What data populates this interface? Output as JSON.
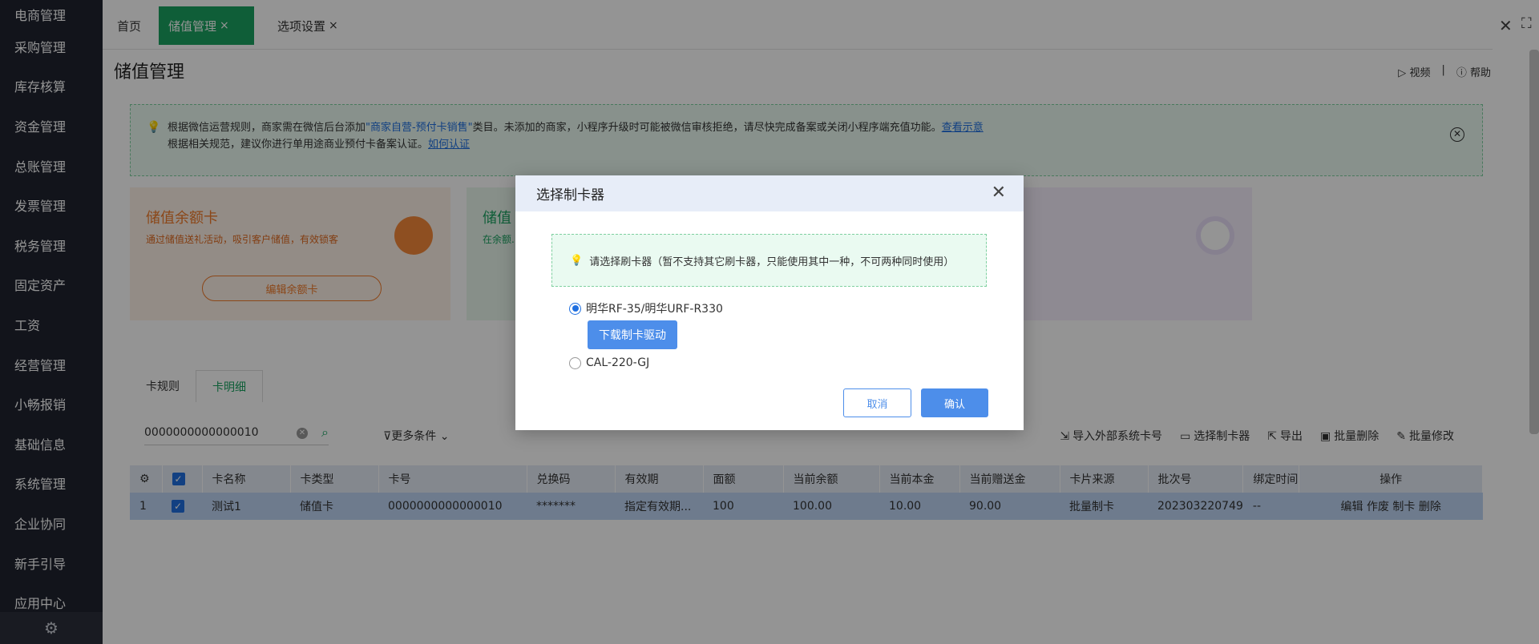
{
  "sidebar": {
    "items": [
      "电商管理",
      "采购管理",
      "库存核算",
      "资金管理",
      "总账管理",
      "发票管理",
      "税务管理",
      "固定资产",
      "工资",
      "经营管理",
      "小畅报销",
      "基础信息",
      "系统管理",
      "企业协同",
      "新手引导",
      "应用中心"
    ],
    "footer_icon": "gear-icon"
  },
  "tabs": [
    {
      "label": "首页"
    },
    {
      "label": "储值管理"
    },
    {
      "label": "选项设置"
    }
  ],
  "tab_close": "×",
  "window": {
    "close": "✕",
    "fullscreen": "⛶"
  },
  "page": {
    "title": "储值管理",
    "video_label": "视频",
    "help_label": "帮助"
  },
  "notice": {
    "line1_a": "根据微信运营规则，商家需在微信后台添加",
    "line1_link": "\"商家自营-预付卡销售\"",
    "line1_b": "类目。未添加的商家，小程序升级时可能被微信审核拒绝，请尽快完成备案或关闭小程序端充值功能。",
    "line1_view": "查看示意",
    "line2_a": "根据相关规范，建议你进行单用途商业预付卡备案认证。",
    "line2_link": "如何认证"
  },
  "cards": [
    {
      "title": "储值余额卡",
      "desc": "通过储值送礼活动，吸引客户储值，有效锁客",
      "button": "编辑余额卡"
    },
    {
      "title": "储值",
      "desc": "在余额... 可以批... 给大客..."
    }
  ],
  "detail_tabs": [
    "卡规则",
    "卡明细"
  ],
  "search": {
    "value": "0000000000000010"
  },
  "more_conditions": "更多条件",
  "toolbar": [
    "导入外部系统卡号",
    "选择制卡器",
    "导出",
    "批量删除",
    "批量修改"
  ],
  "table": {
    "headers": [
      "",
      "",
      "卡名称",
      "卡类型",
      "卡号",
      "兑换码",
      "有效期",
      "面额",
      "当前余额",
      "当前本金",
      "当前赠送金",
      "卡片来源",
      "批次号",
      "绑定时间",
      "操作"
    ],
    "rows": [
      [
        "1",
        "",
        "测试1",
        "储值卡",
        "0000000000000010",
        "*******",
        "指定有效期...",
        "100",
        "100.00",
        "10.00",
        "90.00",
        "批量制卡",
        "202303220749",
        "--",
        "编辑 作废 制卡 删除"
      ]
    ]
  },
  "modal": {
    "title": "选择制卡器",
    "tip": "请选择刷卡器（暂不支持其它刷卡器，只能使用其中一种，不可两种同时使用）",
    "options": [
      "明华RF-35/明华URF-R330",
      "CAL-220-GJ"
    ],
    "selected_index": 0,
    "download_button": "下载制卡驱动",
    "cancel_button": "取消",
    "confirm_button": "确认"
  },
  "colors": {
    "sidebar_bg": "#1f2430",
    "active_tab": "#1aa361",
    "primary_blue": "#4d8eea",
    "modal_header": "#e7edf8"
  }
}
